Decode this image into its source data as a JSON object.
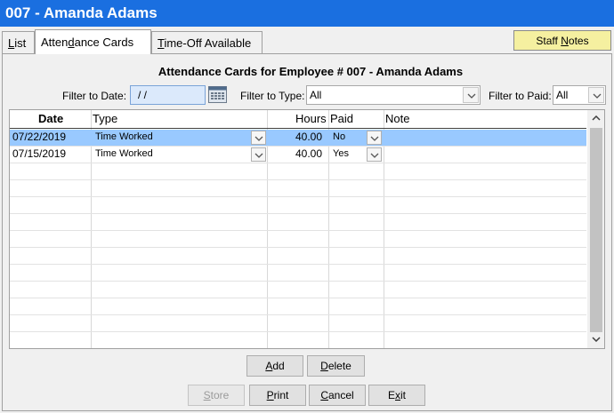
{
  "window": {
    "title": "007 - Amanda Adams"
  },
  "tabs": [
    {
      "label": "List",
      "accel": "L",
      "rest": "ist"
    },
    {
      "label": "Attendance Cards",
      "pre": "Atten",
      "accel": "d",
      "rest": "ance Cards"
    },
    {
      "label": "Time-Off Available",
      "accel": "T",
      "rest": "ime-Off Available"
    }
  ],
  "staff_notes": {
    "pre": "Staff ",
    "accel": "N",
    "rest": "otes"
  },
  "heading": "Attendance Cards for Employee # 007 - Amanda Adams",
  "filters": {
    "date_label": "Filter to Date:",
    "date_value": " / /",
    "type_label": "Filter to Type:",
    "type_value": "All",
    "paid_label": "Filter to Paid:",
    "paid_value": "All"
  },
  "grid": {
    "columns": [
      "Date",
      "Type",
      "Hours",
      "Paid",
      "Note"
    ],
    "rows": [
      {
        "date": "07/22/2019",
        "type": "Time Worked",
        "hours": "40.00",
        "paid": "No",
        "note": ""
      },
      {
        "date": "07/15/2019",
        "type": "Time Worked",
        "hours": "40.00",
        "paid": "Yes",
        "note": ""
      }
    ]
  },
  "buttons": {
    "add": {
      "accel": "A",
      "rest": "dd"
    },
    "delete": {
      "accel": "D",
      "rest": "elete"
    },
    "store": {
      "accel": "S",
      "rest": "tore"
    },
    "print": {
      "accel": "P",
      "rest": "rint"
    },
    "cancel": {
      "accel": "C",
      "rest": "ancel"
    },
    "exit": {
      "pre": "E",
      "accel": "x",
      "rest": "it"
    }
  }
}
